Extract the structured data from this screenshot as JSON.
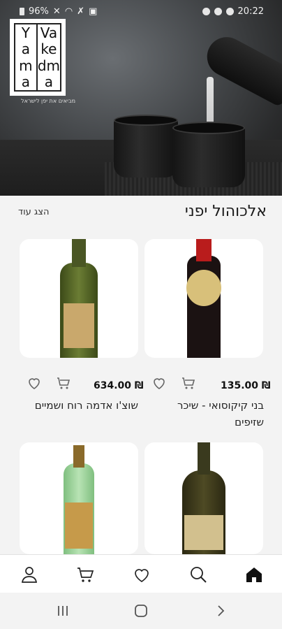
{
  "status_bar": {
    "battery": "96%",
    "time": "20:22"
  },
  "brand": {
    "logo_col_left": [
      "Y",
      "a",
      "m",
      "a"
    ],
    "logo_col_right": [
      "Va",
      "ke",
      "dm",
      "a"
    ],
    "tagline": "מביאים את יפן לישראל"
  },
  "section": {
    "title": "אלכוהול יפני",
    "show_more": "הצג עוד"
  },
  "products": [
    {
      "name": "בני קיקוסואי - שיכר שזיפים",
      "price": "135.00 ₪",
      "bottle_color": "#1b1212",
      "cap_color": "#b91c1c",
      "label_color": "#d8c07a"
    },
    {
      "name": "שוצ'ו אדמה רוח ושמיים",
      "price": "634.00 ₪",
      "bottle_color": "#5a6a2a",
      "cap_color": "#3a3a22",
      "label_color": "#c9a86c"
    },
    {
      "name": "",
      "price": "",
      "bottle_color": "#3e3a1e",
      "cap_color": "#2a2a1a",
      "label_color": "#d2c08e"
    },
    {
      "name": "",
      "price": "",
      "bottle_color": "#9bcf9a",
      "cap_color": "#8a6a2a",
      "label_color": "#c69a4a"
    }
  ],
  "nav": {
    "items": [
      "home-icon",
      "search-icon",
      "heart-icon",
      "cart-icon",
      "user-icon"
    ]
  },
  "colors": {
    "accent": "#111111",
    "card_bg": "#ffffff",
    "page_bg": "#f3f3f3"
  }
}
